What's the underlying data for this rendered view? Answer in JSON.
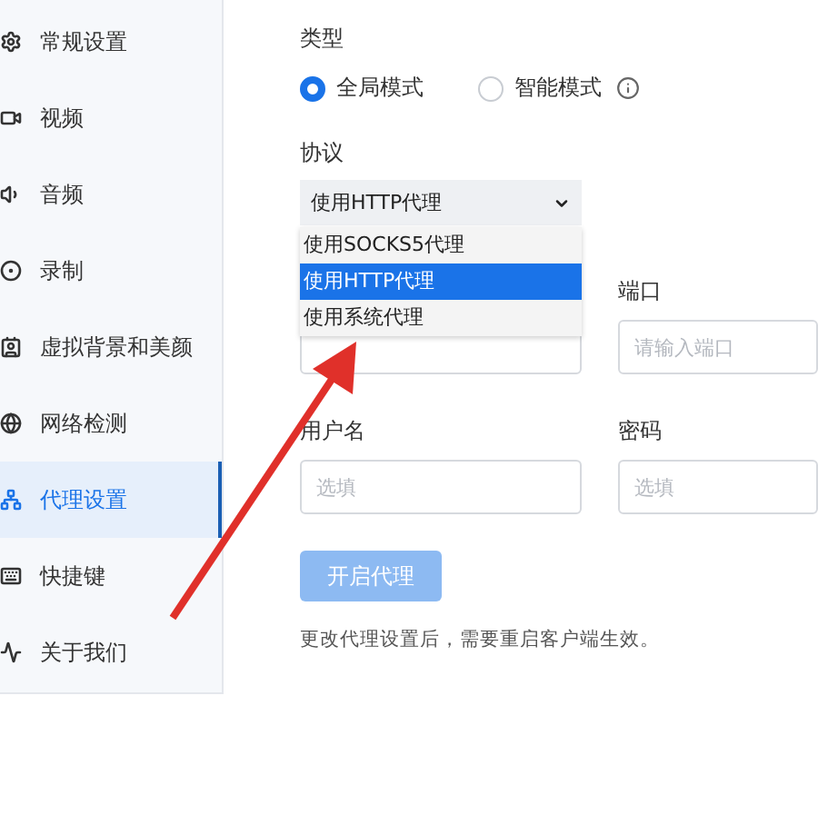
{
  "sidebar": {
    "items": [
      {
        "label": "常规设置",
        "selected": false
      },
      {
        "label": "视频",
        "selected": false
      },
      {
        "label": "音频",
        "selected": false
      },
      {
        "label": "录制",
        "selected": false
      },
      {
        "label": "虚拟背景和美颜",
        "selected": false
      },
      {
        "label": "网络检测",
        "selected": false
      },
      {
        "label": "代理设置",
        "selected": true
      },
      {
        "label": "快捷键",
        "selected": false
      },
      {
        "label": "关于我们",
        "selected": false
      }
    ]
  },
  "form": {
    "type_label": "类型",
    "modes": [
      {
        "label": "全局模式",
        "selected": true
      },
      {
        "label": "智能模式",
        "selected": false
      }
    ],
    "protocol_label": "协议",
    "protocol": {
      "value": "使用HTTP代理",
      "expanded": true,
      "options": [
        {
          "label": "使用SOCKS5代理",
          "selected": false
        },
        {
          "label": "使用HTTP代理",
          "selected": true
        },
        {
          "label": "使用系统代理",
          "selected": false
        }
      ]
    },
    "port": {
      "label": "端口",
      "placeholder": "请输入端口"
    },
    "username": {
      "label": "用户名",
      "placeholder": "选填"
    },
    "password": {
      "label": "密码",
      "placeholder": "选填"
    },
    "button": {
      "label": "开启代理",
      "disabled": true
    },
    "note": "更改代理设置后，需要重启客户端生效。"
  }
}
